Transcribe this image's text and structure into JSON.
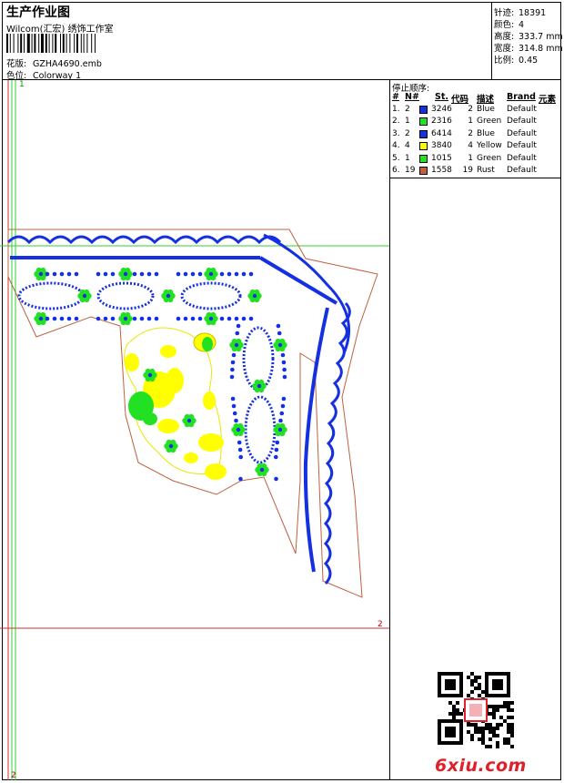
{
  "header": {
    "title": "生产作业图",
    "subtitle": "Wilcom(汇宏) 绣饰工作室",
    "pattern_label": "花版:",
    "pattern_value": "GZHA4690.emb",
    "color_label": "色位:",
    "color_value": "Colorway 1"
  },
  "stats": [
    {
      "label": "针迹:",
      "value": "18391"
    },
    {
      "label": "颜色:",
      "value": "4"
    },
    {
      "label": "高度:",
      "value": "333.7 mm"
    },
    {
      "label": "宽度:",
      "value": "314.8 mm"
    },
    {
      "label": "比例:",
      "value": "0.45"
    }
  ],
  "stop_sequence": {
    "title": "停止顺序:",
    "headers": {
      "idx": "#",
      "n": "N#",
      "st": "St.",
      "code": "代码",
      "desc": "描述",
      "brand": "Brand",
      "elem": "元素"
    },
    "rows": [
      {
        "idx": "1.",
        "n": "2",
        "color": "#1530e0",
        "st": "3246",
        "code": "2",
        "desc": "Blue",
        "brand": "Default"
      },
      {
        "idx": "2.",
        "n": "1",
        "color": "#22e022",
        "st": "2316",
        "code": "1",
        "desc": "Green",
        "brand": "Default"
      },
      {
        "idx": "3.",
        "n": "2",
        "color": "#1530e0",
        "st": "6414",
        "code": "2",
        "desc": "Blue",
        "brand": "Default"
      },
      {
        "idx": "4.",
        "n": "4",
        "color": "#ffff00",
        "st": "3840",
        "code": "4",
        "desc": "Yellow",
        "brand": "Default"
      },
      {
        "idx": "5.",
        "n": "1",
        "color": "#22e022",
        "st": "1015",
        "code": "1",
        "desc": "Green",
        "brand": "Default"
      },
      {
        "idx": "6.",
        "n": "19",
        "color": "#c06040",
        "st": "1558",
        "code": "19",
        "desc": "Rust",
        "brand": "Default"
      }
    ]
  },
  "canvas": {
    "mark_1": "1",
    "mark_2": "2",
    "mark_2b": "2"
  },
  "colors": {
    "blue": "#1530e0",
    "green": "#22e022",
    "yellow": "#ffff00",
    "rust": "#c06040",
    "guide_red": "#d03030",
    "guide_green": "#30d030"
  },
  "watermark": {
    "site": "6xiu.com"
  }
}
